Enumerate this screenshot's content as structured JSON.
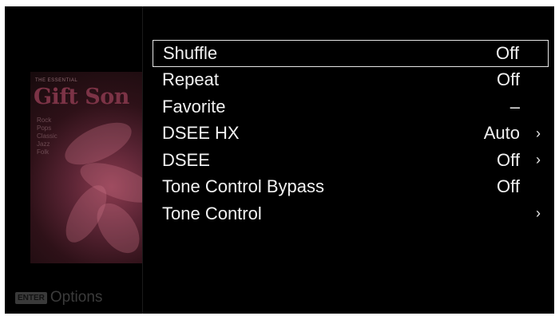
{
  "cover": {
    "small_text": "THE ESSENTIAL",
    "title": "Gift Son",
    "genres": [
      "Rock",
      "Pops",
      "Classic",
      "Jazz",
      "Folk"
    ]
  },
  "footer": {
    "enter_key": "ENTER",
    "options_label": "Options"
  },
  "menu": {
    "selected_index": 0,
    "items": [
      {
        "label": "Shuffle",
        "value": "Off",
        "chevron": ""
      },
      {
        "label": "Repeat",
        "value": "Off",
        "chevron": ""
      },
      {
        "label": "Favorite",
        "value": "–",
        "chevron": ""
      },
      {
        "label": "DSEE HX",
        "value": "Auto",
        "chevron": "›"
      },
      {
        "label": "DSEE",
        "value": "Off",
        "chevron": "›"
      },
      {
        "label": "Tone Control Bypass",
        "value": "Off",
        "chevron": ""
      },
      {
        "label": "Tone Control",
        "value": "",
        "chevron": "›"
      }
    ]
  },
  "colors": {
    "background": "#000000",
    "text": "#f2f2f2",
    "selection_border": "#e6e6e6"
  }
}
